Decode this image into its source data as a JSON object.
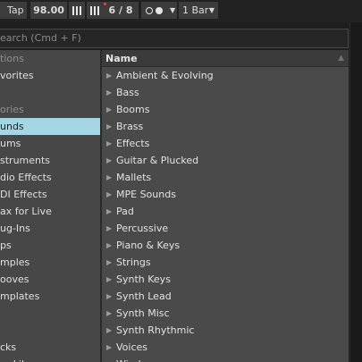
{
  "transport": {
    "tap_label": "Tap",
    "tempo": "98.00",
    "meter": "6 / 8",
    "quantize": "1 Bar"
  },
  "search": {
    "placeholder": "earch (Cmd + F)"
  },
  "sidebar": {
    "items": [
      {
        "label": "tions",
        "type": "header"
      },
      {
        "label": "vorites",
        "type": "item"
      },
      {
        "label": "",
        "type": "blank"
      },
      {
        "label": "ories",
        "type": "header"
      },
      {
        "label": "unds",
        "type": "item",
        "selected": true
      },
      {
        "label": "ums",
        "type": "item"
      },
      {
        "label": "struments",
        "type": "item"
      },
      {
        "label": "dio Effects",
        "type": "item"
      },
      {
        "label": "DI Effects",
        "type": "item"
      },
      {
        "label": "ax for Live",
        "type": "item"
      },
      {
        "label": "ug-Ins",
        "type": "item"
      },
      {
        "label": "ps",
        "type": "item"
      },
      {
        "label": "mples",
        "type": "item"
      },
      {
        "label": "ooves",
        "type": "item"
      },
      {
        "label": "mplates",
        "type": "item"
      },
      {
        "label": "",
        "type": "blank"
      },
      {
        "label": "",
        "type": "blank"
      },
      {
        "label": "cks",
        "type": "item"
      },
      {
        "label": "er Library",
        "type": "item"
      }
    ]
  },
  "browser": {
    "column_header": "Name",
    "items": [
      "Ambient & Evolving",
      "Bass",
      "Booms",
      "Brass",
      "Effects",
      "Guitar & Plucked",
      "Mallets",
      "MPE Sounds",
      "Pad",
      "Percussive",
      "Piano & Keys",
      "Strings",
      "Synth Keys",
      "Synth Lead",
      "Synth Misc",
      "Synth Rhythmic",
      "Voices",
      "Winds"
    ]
  }
}
